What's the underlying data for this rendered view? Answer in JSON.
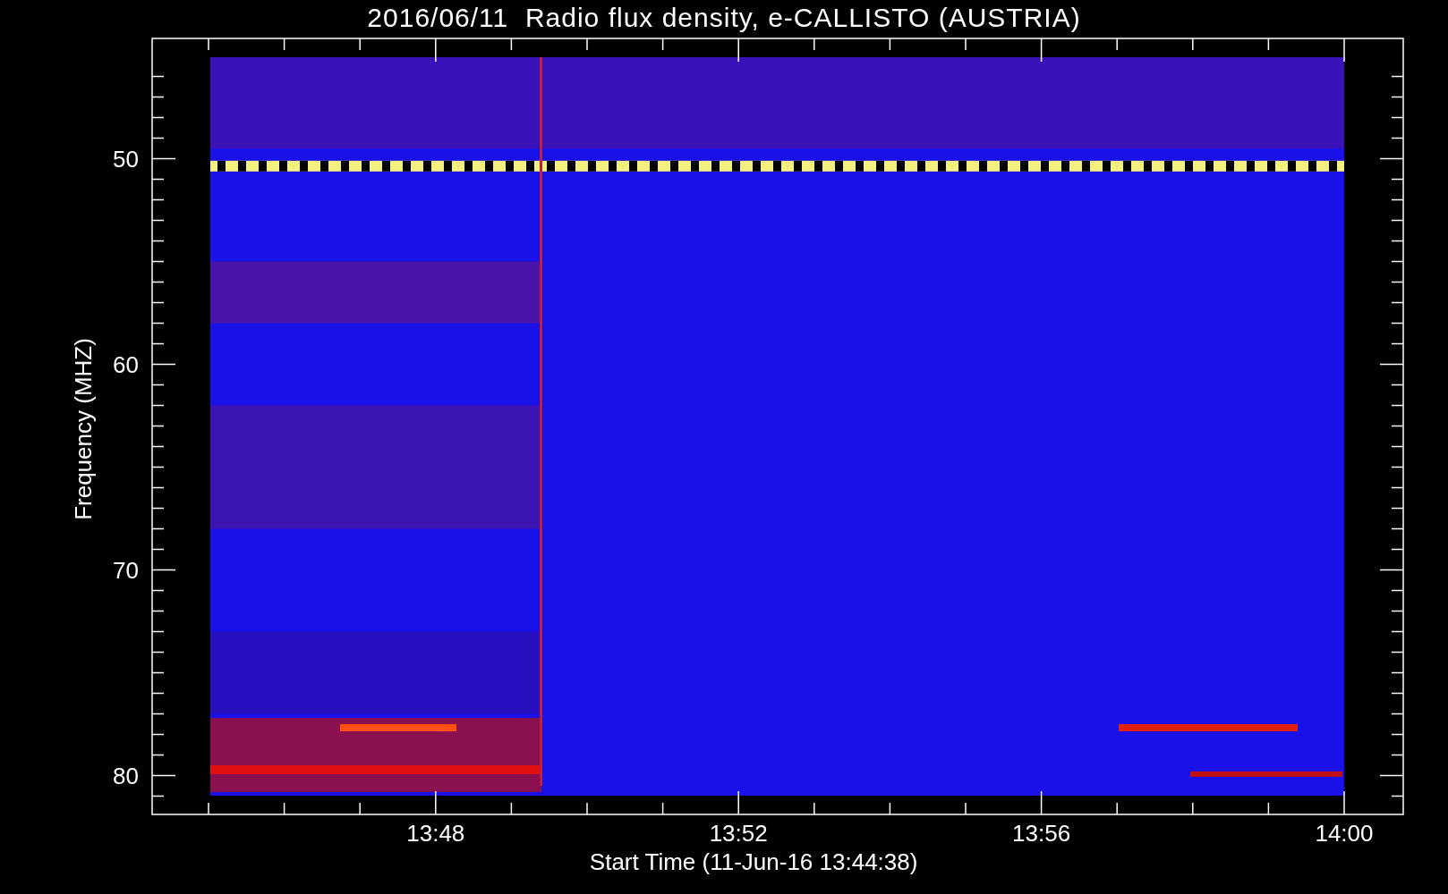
{
  "title": "2016/06/11  Radio flux density, e-CALLISTO (AUSTRIA)",
  "y_axis": {
    "label": "Frequency (MHZ)",
    "ticks": [
      "50",
      "60",
      "70",
      "80"
    ]
  },
  "x_axis": {
    "label": "Start Time (11-Jun-16 13:44:38)",
    "ticks": [
      "13:48",
      "13:52",
      "13:56",
      "14:00"
    ]
  }
}
